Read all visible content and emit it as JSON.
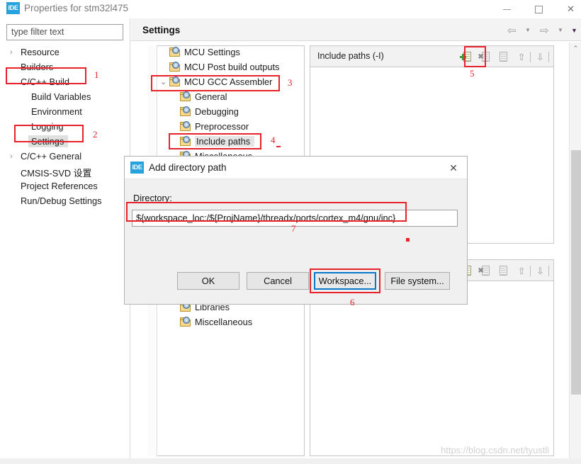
{
  "window": {
    "title": "Properties for stm32l475",
    "badge": "IDE",
    "minimize": "—",
    "maximize": "□",
    "close": "✕"
  },
  "left_panel": {
    "filter_placeholder": "type filter text",
    "filter_value": "",
    "tree": [
      {
        "label": "Resource",
        "arrow": "›",
        "indent": 0,
        "selected": false
      },
      {
        "label": "Builders",
        "arrow": "",
        "indent": 0,
        "selected": false
      },
      {
        "label": "C/C++ Build",
        "arrow": "⌄",
        "indent": 0,
        "selected": false
      },
      {
        "label": "Build Variables",
        "arrow": "",
        "indent": 1,
        "selected": false
      },
      {
        "label": "Environment",
        "arrow": "",
        "indent": 1,
        "selected": false
      },
      {
        "label": "Logging",
        "arrow": "",
        "indent": 1,
        "selected": false
      },
      {
        "label": "Settings",
        "arrow": "",
        "indent": 1,
        "selected": true
      },
      {
        "label": "C/C++ General",
        "arrow": "›",
        "indent": 0,
        "selected": false
      },
      {
        "label": "CMSIS-SVD 设置",
        "arrow": "",
        "indent": 0,
        "selected": false
      },
      {
        "label": "Project References",
        "arrow": "",
        "indent": 0,
        "selected": false
      },
      {
        "label": "Run/Debug Settings",
        "arrow": "",
        "indent": 0,
        "selected": false
      }
    ]
  },
  "header": {
    "title": "Settings",
    "back_icon": "⇦",
    "forward_icon": "⇨",
    "caret_icon": "▼"
  },
  "settings_tree": [
    {
      "label": "MCU Settings",
      "arrow": "",
      "indent": 0,
      "selected": false
    },
    {
      "label": "MCU Post build outputs",
      "arrow": "",
      "indent": 0,
      "selected": false
    },
    {
      "label": "MCU GCC Assembler",
      "arrow": "⌄",
      "indent": 0,
      "selected": false,
      "disc": true
    },
    {
      "label": "General",
      "arrow": "",
      "indent": 1,
      "selected": false
    },
    {
      "label": "Debugging",
      "arrow": "",
      "indent": 1,
      "selected": false
    },
    {
      "label": "Preprocessor",
      "arrow": "",
      "indent": 1,
      "selected": false
    },
    {
      "label": "Include paths",
      "arrow": "",
      "indent": 1,
      "selected": true
    },
    {
      "label": "Miscellaneous",
      "arrow": "",
      "indent": 1,
      "selected": false
    }
  ],
  "settings_tree_lower": [
    {
      "label": "Libraries",
      "indent": 1
    },
    {
      "label": "Miscellaneous",
      "indent": 1
    }
  ],
  "include_paths_panel": {
    "header": "Include paths (-I)",
    "items": [],
    "toolbar": [
      {
        "name": "add-icon",
        "kind": "add"
      },
      {
        "name": "delete-icon",
        "kind": "delete"
      },
      {
        "name": "edit-icon",
        "kind": "edit"
      },
      {
        "name": "move-up-icon",
        "kind": "up"
      },
      {
        "name": "move-down-icon",
        "kind": "down"
      }
    ]
  },
  "dialog": {
    "badge": "IDE",
    "title": "Add directory path",
    "close": "✕",
    "directory_label": "Directory:",
    "directory_value": "${workspace_loc:/${ProjName}/threadx/ports/cortex_m4/gnu/inc}",
    "buttons": {
      "ok": "OK",
      "cancel": "Cancel",
      "workspace": "Workspace...",
      "file_system": "File system..."
    }
  },
  "annotations": {
    "n1": "1",
    "n2": "2",
    "n3": "3",
    "n4": "4",
    "n5": "5",
    "n6": "6",
    "n7": "7",
    "color": "#e8222a"
  },
  "scrollbar": {
    "up": "⌃",
    "down": "⌄"
  },
  "watermark": "https://blog.csdn.net/tyustli"
}
